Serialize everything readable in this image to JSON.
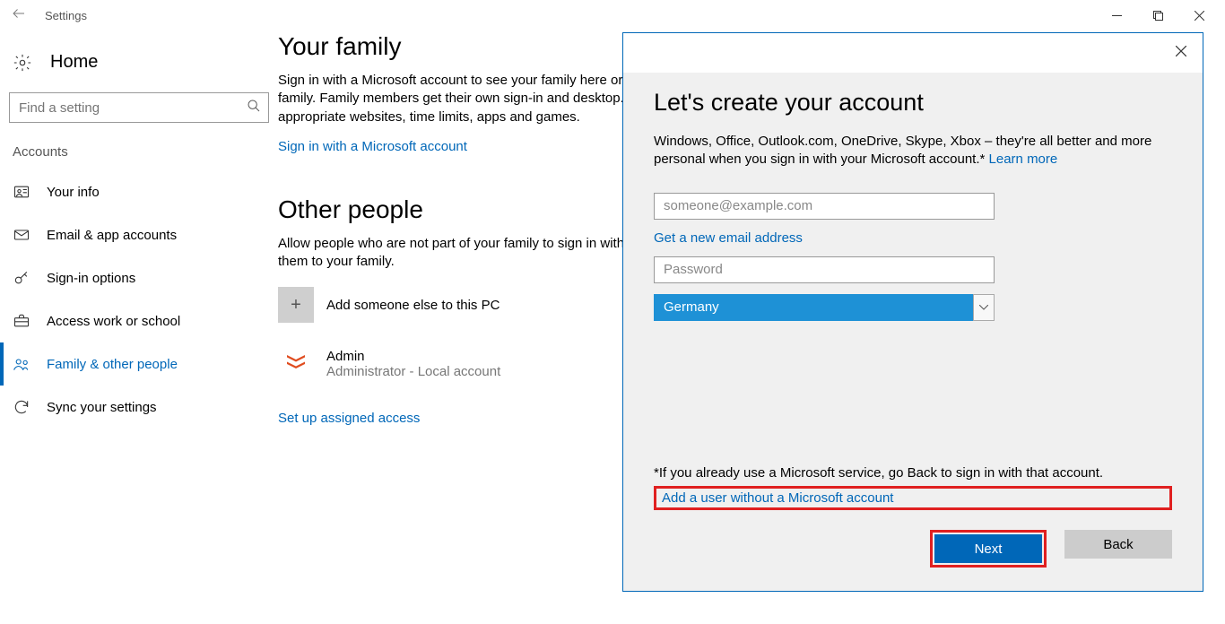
{
  "window": {
    "title": "Settings"
  },
  "sidebar": {
    "home": "Home",
    "search_placeholder": "Find a setting",
    "section": "Accounts",
    "items": [
      {
        "label": "Your info",
        "icon": "user-icon"
      },
      {
        "label": "Email & app accounts",
        "icon": "mail-icon"
      },
      {
        "label": "Sign-in options",
        "icon": "key-icon"
      },
      {
        "label": "Access work or school",
        "icon": "briefcase-icon"
      },
      {
        "label": "Family & other people",
        "icon": "people-icon"
      },
      {
        "label": "Sync your settings",
        "icon": "sync-icon"
      }
    ]
  },
  "main": {
    "h1": "Your family",
    "p1": "Sign in with a Microsoft account to see your family here or add any new members to your family. Family members get their own sign-in and desktop. You can help kids to stay safe with appropriate websites, time limits, apps and games.",
    "link_signin": "Sign in with a Microsoft account",
    "h2": "Other people",
    "p2": "Allow people who are not part of your family to sign in with their own accounts. This won't add them to your family.",
    "add_someone": "Add someone else to this PC",
    "admin_name": "Admin",
    "admin_sub": "Administrator - Local account",
    "assigned": "Set up assigned access"
  },
  "dialog": {
    "title": "Let's create your account",
    "sub_a": "Windows, Office, Outlook.com, OneDrive, Skype, Xbox – they're all better and more personal when you sign in with your Microsoft account.* ",
    "learn": "Learn more",
    "email_ph": "someone@example.com",
    "newmail": "Get a new email address",
    "pass_ph": "Password",
    "country": "Germany",
    "already": "*If you already use a Microsoft service, go Back to sign in with that account.",
    "add_no_ms": "Add a user without a Microsoft account",
    "next": "Next",
    "back": "Back"
  }
}
